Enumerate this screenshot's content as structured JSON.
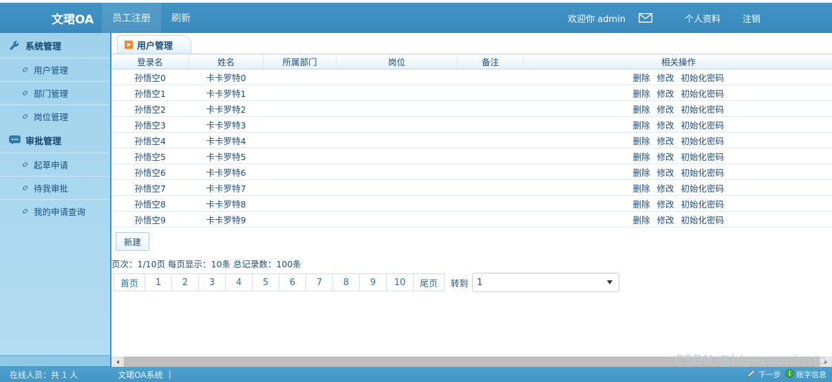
{
  "header": {
    "logo": "文珺OA",
    "tabs": [
      {
        "label": "员工注册",
        "active": true
      },
      {
        "label": "刷新",
        "active": false
      }
    ],
    "welcome": "欢迎你 admin",
    "mail_icon": "envelope-icon",
    "links": [
      {
        "label": "个人资料"
      },
      {
        "label": "注销"
      }
    ]
  },
  "sidebar": {
    "groups": [
      {
        "title": "系统管理",
        "icon": "wrench-icon",
        "items": [
          {
            "label": "用户管理",
            "icon": "link-icon"
          },
          {
            "label": "部门管理",
            "icon": "link-icon"
          },
          {
            "label": "岗位管理",
            "icon": "link-icon"
          }
        ]
      },
      {
        "title": "审批管理",
        "icon": "chat-icon",
        "items": [
          {
            "label": "起草申请",
            "icon": "link-icon"
          },
          {
            "label": "待我审批",
            "icon": "link-icon"
          },
          {
            "label": "我的申请查询",
            "icon": "link-icon"
          }
        ]
      }
    ]
  },
  "panel": {
    "tab_label": "用户管理",
    "tab_icon": "play-square-icon"
  },
  "table": {
    "columns": [
      "登录名",
      "姓名",
      "所属部门",
      "岗位",
      "备注",
      "相关操作"
    ],
    "ops": [
      "删除",
      "修改",
      "初始化密码"
    ],
    "rows": [
      {
        "login": "孙悟空0",
        "name": "卡卡罗特0",
        "dept": "",
        "post": "",
        "remark": ""
      },
      {
        "login": "孙悟空1",
        "name": "卡卡罗特1",
        "dept": "",
        "post": "",
        "remark": ""
      },
      {
        "login": "孙悟空2",
        "name": "卡卡罗特2",
        "dept": "",
        "post": "",
        "remark": ""
      },
      {
        "login": "孙悟空3",
        "name": "卡卡罗特3",
        "dept": "",
        "post": "",
        "remark": ""
      },
      {
        "login": "孙悟空4",
        "name": "卡卡罗特4",
        "dept": "",
        "post": "",
        "remark": ""
      },
      {
        "login": "孙悟空5",
        "name": "卡卡罗特5",
        "dept": "",
        "post": "",
        "remark": ""
      },
      {
        "login": "孙悟空6",
        "name": "卡卡罗特6",
        "dept": "",
        "post": "",
        "remark": ""
      },
      {
        "login": "孙悟空7",
        "name": "卡卡罗特7",
        "dept": "",
        "post": "",
        "remark": ""
      },
      {
        "login": "孙悟空8",
        "name": "卡卡罗特8",
        "dept": "",
        "post": "",
        "remark": ""
      },
      {
        "login": "孙悟空9",
        "name": "卡卡罗特9",
        "dept": "",
        "post": "",
        "remark": ""
      }
    ]
  },
  "actions": {
    "new_button": "新建"
  },
  "pagination": {
    "info": "页次：1/10页  每页显示：10条  总记录数：100条",
    "first": "首页",
    "last": "尾页",
    "pages": [
      "1",
      "2",
      "3",
      "4",
      "5",
      "6",
      "7",
      "8",
      "9",
      "10"
    ],
    "goto_label": "转到",
    "goto_value": "1"
  },
  "footer": {
    "online": "在线人员：共 1 人",
    "system": "文珺OA系统",
    "separator": "|",
    "tray": [
      {
        "label": "下一步",
        "icon": "pen-icon"
      },
      {
        "label": "账字信息",
        "icon": "info-icon"
      }
    ]
  },
  "watermark": "CSDN @biyezuopinvip"
}
